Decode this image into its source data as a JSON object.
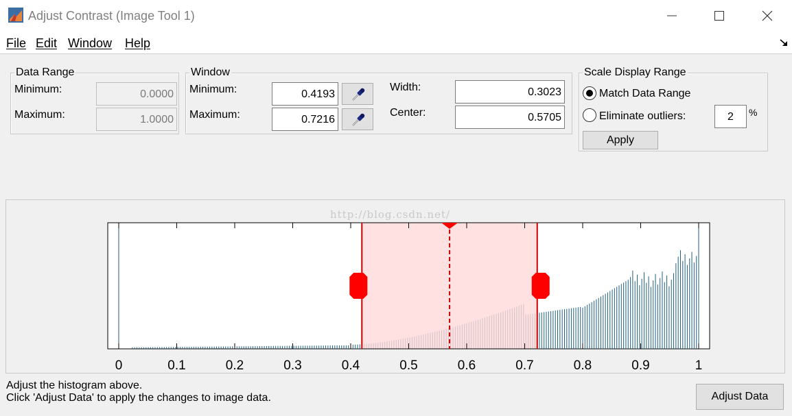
{
  "window": {
    "title": "Adjust Contrast (Image Tool 1)"
  },
  "menu": {
    "items": [
      "File",
      "Edit",
      "Window",
      "Help"
    ]
  },
  "data_range": {
    "title": "Data Range",
    "minimum_label": "Minimum:",
    "minimum_value": "0.0000",
    "maximum_label": "Maximum:",
    "maximum_value": "1.0000"
  },
  "window_group": {
    "title": "Window",
    "minimum_label": "Minimum:",
    "minimum_value": "0.4193",
    "maximum_label": "Maximum:",
    "maximum_value": "0.7216",
    "width_label": "Width:",
    "width_value": "0.3023",
    "center_label": "Center:",
    "center_value": "0.5705"
  },
  "scale_display": {
    "title": "Scale Display Range",
    "match_label": "Match Data Range",
    "match_selected": true,
    "eliminate_label": "Eliminate outliers:",
    "eliminate_selected": false,
    "outlier_value": "2",
    "percent_symbol": "%",
    "apply_label": "Apply"
  },
  "watermark": "http://blog.csdn.net/",
  "histogram": {
    "x_ticks": [
      "0",
      "0.1",
      "0.2",
      "0.3",
      "0.4",
      "0.5",
      "0.6",
      "0.7",
      "0.8",
      "0.9",
      "1"
    ],
    "window_min": 0.4193,
    "window_max": 0.7216,
    "window_center": 0.5705,
    "bar_color": "#1f5f7f",
    "window_fill": "#ffdada",
    "window_edge": "#cc0000",
    "handle_color": "#ff0000"
  },
  "status": {
    "line1": "Adjust the histogram above.",
    "line2": "Click 'Adjust Data' to apply the changes to image data."
  },
  "adjust_data_label": "Adjust Data",
  "icons": {
    "app": "matlab-icon",
    "minimize": "minimize-icon",
    "maximize": "maximize-icon",
    "close": "close-icon",
    "dock": "dock-arrow-icon",
    "eyedropper": "eyedropper-icon"
  }
}
